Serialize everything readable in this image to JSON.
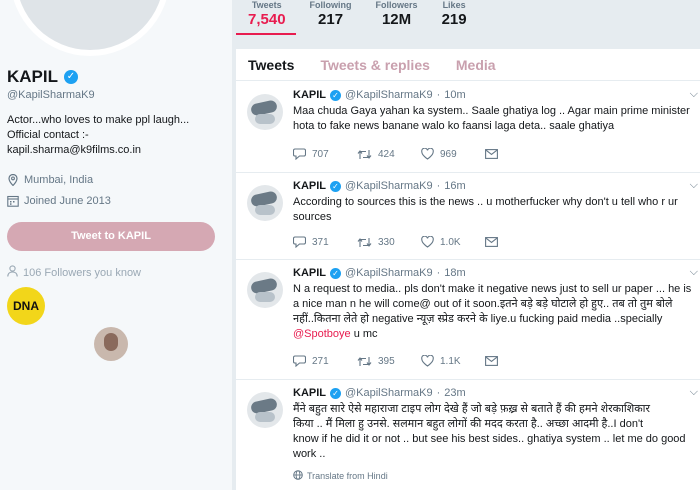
{
  "profile": {
    "name": "KAPIL",
    "handle": "@KapilSharmaK9",
    "bio_lines": [
      "Actor...who loves to make ppl laugh...",
      "Official contact :-",
      "kapil.sharma@k9films.co.in"
    ],
    "location": "Mumbai, India",
    "joined": "Joined June 2013",
    "tweet_to_label": "Tweet to KAPIL",
    "followers_you_know": "106 Followers you know",
    "dna_logo_text": "DNA"
  },
  "stats": [
    {
      "label": "Tweets",
      "value": "7,540"
    },
    {
      "label": "Following",
      "value": "217"
    },
    {
      "label": "Followers",
      "value": "12M"
    },
    {
      "label": "Likes",
      "value": "219"
    }
  ],
  "tabs": [
    "Tweets",
    "Tweets & replies",
    "Media"
  ],
  "tweets": [
    {
      "name": "KAPIL",
      "handle": "@KapilSharmaK9",
      "time": "10m",
      "lines": [
        "Maa chuda Gaya yahan ka system.. Saale ghatiya log .. Agar main prime minister",
        "hota to fake news banane walo ko faansi laga deta.. saale ghatiya"
      ],
      "replies": "707",
      "retweets": "424",
      "likes": "969"
    },
    {
      "name": "KAPIL",
      "handle": "@KapilSharmaK9",
      "time": "16m",
      "lines": [
        "According to sources this is the news .. u motherfucker why don't u tell who r ur",
        "sources"
      ],
      "replies": "371",
      "retweets": "330",
      "likes": "1.0K"
    },
    {
      "name": "KAPIL",
      "handle": "@KapilSharmaK9",
      "time": "18m",
      "lines": [
        "N a request to media.. pls don't make it negative news just to sell ur paper ... he is",
        "a nice man n he will come@ out of it soon.इतने बड़े बड़े घोटाले हो हुए.. तब तो तुम बोले",
        "नहीं..कितना लेते हो negative न्यूज़ स्प्रेड करने के liye.u fucking paid media ..specially"
      ],
      "mention": "@Spotboye",
      "mention_suffix": " u mc",
      "replies": "271",
      "retweets": "395",
      "likes": "1.1K"
    },
    {
      "name": "KAPIL",
      "handle": "@KapilSharmaK9",
      "time": "23m",
      "lines": [
        "मैंने बहुत सारे ऐसे महाराजा टाइप लोग देखे हैं जो बड़े फ़ख़्र से बताते हैं की हमने शेरकाशिकार",
        "किया .. मैं मिला हु उनसे. सलमान बहुत लोगों की मदद करता है.. अच्छा आदमी है..I don't",
        "know if he did it or not .. but see his best sides.. ghatiya system .. let me do good",
        "work .."
      ],
      "translate": "Translate from Hindi"
    }
  ],
  "colors": {
    "accent": "#e81c4f",
    "verified": "#1da1f2",
    "muted": "#657786"
  }
}
